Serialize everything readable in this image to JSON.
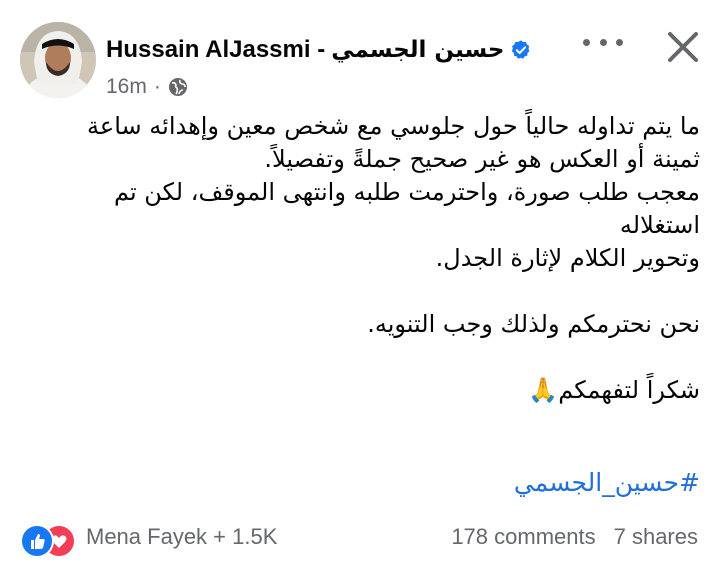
{
  "post": {
    "author_latin": "Hussain AlJassmi -",
    "author_arabic": "حسين الجسمي",
    "time": "16m",
    "separator": "·",
    "body": "ما يتم تداوله حالياً حول جلوسي مع شخص معين وإهدائه ساعة\nثمينة أو العكس هو غير صحيح جملةً وتفصيلاً.\nمعجب طلب صورة، واحترمت طلبه وانتهى الموقف، لكن تم استغلاله\nوتحوير الكلام لإثارة الجدل.\n\nنحن نحترمكم ولذلك وجب التنويه.\n\nشكراً لتفهمكم🙏",
    "hashtag": "#حسين_الجسمي"
  },
  "footer": {
    "reactions_label": "Mena Fayek + 1.5K",
    "comments": "178 comments",
    "shares": "7 shares"
  },
  "colors": {
    "verified": "#1877f2",
    "hashtag": "#216fdb",
    "secondary_text": "#65676b",
    "like": "#1877f2",
    "love": "#f33e58"
  },
  "icons": [
    "verified-badge-icon",
    "globe-icon",
    "more-icon",
    "close-icon",
    "like-reaction-icon",
    "love-reaction-icon"
  ]
}
